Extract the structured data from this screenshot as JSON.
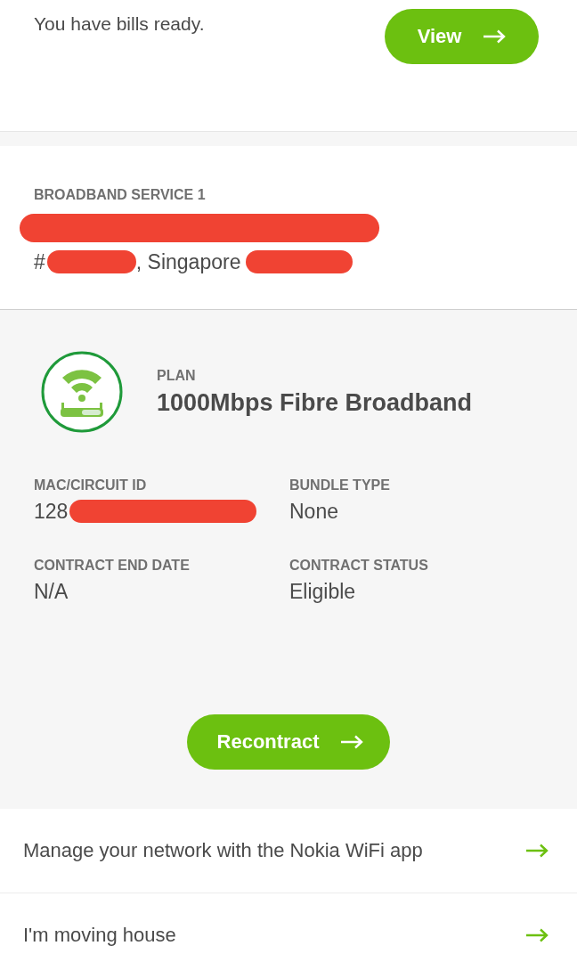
{
  "bills": {
    "message": "You have bills ready.",
    "button": "View"
  },
  "service": {
    "heading": "BROADBAND SERVICE 1",
    "address_lines": [
      {
        "parts": [
          {
            "kind": "redacted"
          }
        ]
      },
      {
        "parts": [
          {
            "kind": "text",
            "text": "#"
          },
          {
            "kind": "redacted"
          },
          {
            "kind": "text",
            "text": ", Singapore"
          },
          {
            "kind": "redacted"
          }
        ]
      }
    ]
  },
  "plan": {
    "label": "PLAN",
    "name": "1000Mbps Fibre Broadband",
    "fields": [
      {
        "label": "MAC/CIRCUIT ID",
        "parts": [
          {
            "kind": "text",
            "text": "128"
          },
          {
            "kind": "redacted"
          }
        ]
      },
      {
        "label": "BUNDLE TYPE",
        "parts": [
          {
            "kind": "text",
            "text": "None"
          }
        ]
      },
      {
        "label": "CONTRACT END DATE",
        "parts": [
          {
            "kind": "text",
            "text": "N/A"
          }
        ]
      },
      {
        "label": "CONTRACT STATUS",
        "parts": [
          {
            "kind": "text",
            "text": "Eligible"
          }
        ]
      }
    ],
    "button": "Recontract"
  },
  "links": [
    {
      "label": "Manage your network with the Nokia WiFi app"
    },
    {
      "label": "I'm moving house"
    }
  ]
}
